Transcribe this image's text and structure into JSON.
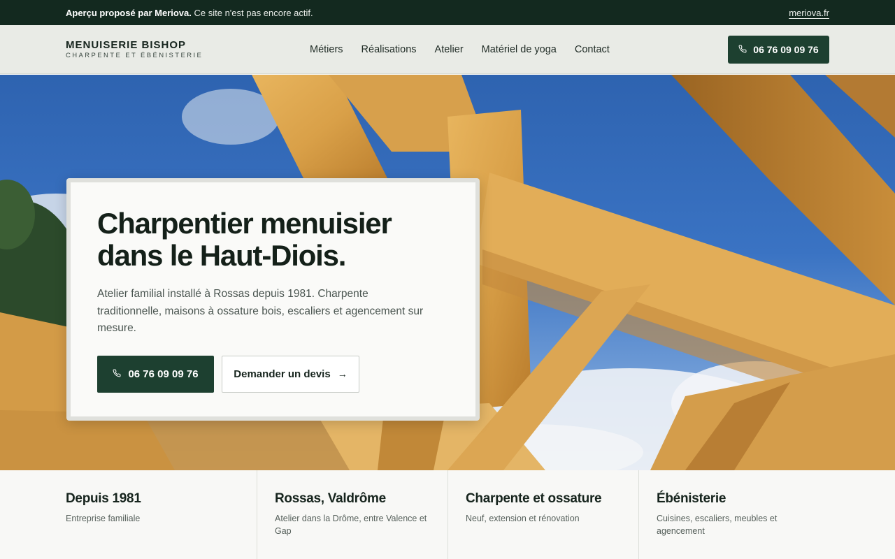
{
  "preview_bar": {
    "message_strong": "Aperçu proposé par Meriova.",
    "message_rest": " Ce site n'est pas encore actif.",
    "link": "meriova.fr"
  },
  "header": {
    "brand_name": "MENUISERIE BISHOP",
    "brand_tagline": "CHARPENTE ET ÉBÉNISTERIE",
    "nav": [
      "Métiers",
      "Réalisations",
      "Atelier",
      "Matériel de yoga",
      "Contact"
    ],
    "cta_phone": "06 76 09 09 76",
    "cta_icon": "phone-icon"
  },
  "hero": {
    "title": "Charpentier menuisier dans le Haut-Diois.",
    "description": "Atelier familial installé à Rossas depuis 1981. Charpente traditionnelle, maisons à ossature bois, escaliers et agencement sur mesure.",
    "primary_button": "06 76 09 09 76",
    "secondary_button": "Demander un devis",
    "secondary_icon": "arrow-right-icon"
  },
  "features": [
    {
      "title": "Depuis 1981",
      "text": "Entreprise familiale"
    },
    {
      "title": "Rossas, Valdrôme",
      "text": "Atelier dans la Drôme, entre Valence et Gap"
    },
    {
      "title": "Charpente et ossature",
      "text": "Neuf, extension et rénovation"
    },
    {
      "title": "Ébénisterie",
      "text": "Cuisines, escaliers, meubles et agencement"
    }
  ],
  "colors": {
    "accent": "#1d4030",
    "preview_bar": "#13291f",
    "header_bg": "#e9ebe6"
  }
}
